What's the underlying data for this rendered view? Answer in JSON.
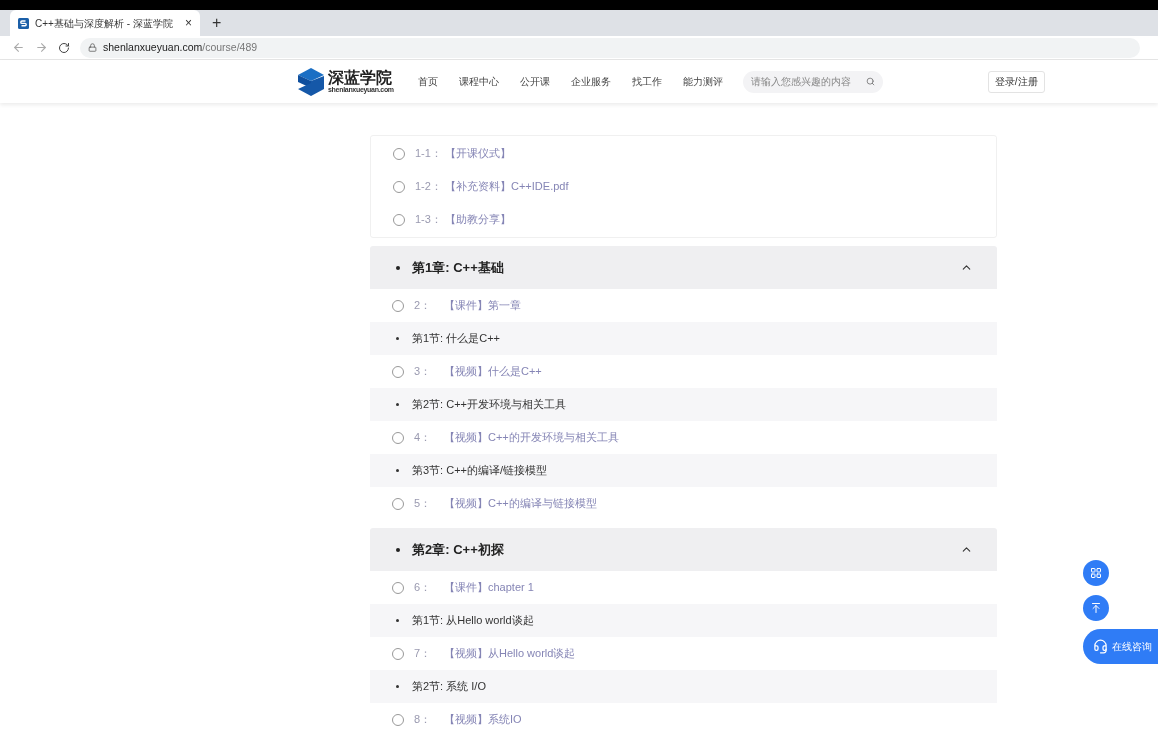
{
  "browser": {
    "tab_title": "C++基础与深度解析 - 深蓝学院",
    "tab_close": "×",
    "new_tab": "+",
    "address": {
      "host": "shenlanxueyuan.com",
      "path": "/course/489"
    }
  },
  "site_header": {
    "logo_name": "深蓝学院",
    "logo_domain": "shenlanxueyuan.com",
    "nav": [
      {
        "label": "首页"
      },
      {
        "label": "课程中心"
      },
      {
        "label": "公开课"
      },
      {
        "label": "企业服务"
      },
      {
        "label": "找工作"
      },
      {
        "label": "能力测评"
      }
    ],
    "search": {
      "placeholder": "请输入您感兴趣的内容"
    },
    "login": "登录/注册"
  },
  "intro_items": [
    {
      "number": "1-1：",
      "title": "【开课仪式】"
    },
    {
      "number": "1-2：",
      "title": "【补充资料】C++IDE.pdf"
    },
    {
      "number": "1-3：",
      "title": "【助教分享】"
    }
  ],
  "chapters": [
    {
      "title": "第1章: C++基础",
      "expanded": true,
      "items": [
        {
          "kind": "lesson",
          "number": "2：",
          "title": "【课件】第一章"
        },
        {
          "kind": "section",
          "title": "第1节: 什么是C++"
        },
        {
          "kind": "lesson",
          "number": "3：",
          "title": "【视频】什么是C++"
        },
        {
          "kind": "section",
          "title": "第2节: C++开发环境与相关工具"
        },
        {
          "kind": "lesson",
          "number": "4：",
          "title": "【视频】C++的开发环境与相关工具"
        },
        {
          "kind": "section",
          "title": "第3节: C++的编译/链接模型"
        },
        {
          "kind": "lesson",
          "number": "5：",
          "title": "【视频】C++的编译与链接模型"
        }
      ]
    },
    {
      "title": "第2章: C++初探",
      "expanded": true,
      "items": [
        {
          "kind": "lesson",
          "number": "6：",
          "title": "【课件】chapter 1"
        },
        {
          "kind": "section",
          "title": "第1节: 从Hello world谈起"
        },
        {
          "kind": "lesson",
          "number": "7：",
          "title": "【视频】从Hello world谈起"
        },
        {
          "kind": "section",
          "title": "第2节: 系统 I/O"
        },
        {
          "kind": "lesson",
          "number": "8：",
          "title": "【视频】系统IO"
        }
      ]
    }
  ],
  "floating": {
    "consult": "在线咨询"
  }
}
